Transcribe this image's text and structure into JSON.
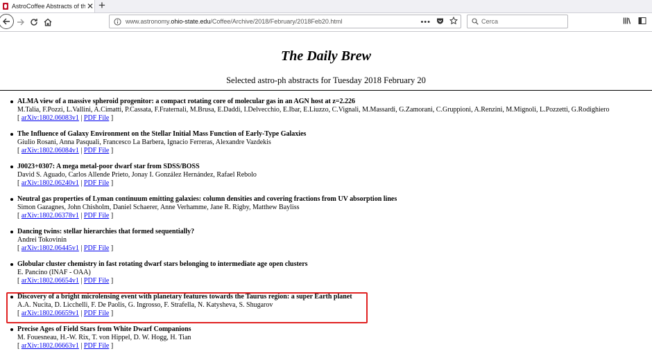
{
  "browser": {
    "tab_title": "AstroCoffee Abstracts of the D",
    "url_prefix": "www.astronomy.",
    "url_domain": "ohio-state.edu",
    "url_path": "/Coffee/Archive/2018/February/2018Feb20.html",
    "search_placeholder": "Cerca",
    "icons": {
      "favicon": "osu-favicon-icon",
      "close": "close-icon",
      "newtab": "plus-icon",
      "back": "back-arrow-icon",
      "forward": "forward-arrow-icon",
      "reload": "reload-icon",
      "home": "home-icon",
      "info": "info-icon",
      "menu": "ellipsis-icon",
      "pocket": "pocket-icon",
      "bookmark": "star-icon",
      "search": "search-icon",
      "library": "library-icon",
      "sidebar": "sidebar-icon"
    },
    "colors": {
      "favicon": "#c0102a"
    }
  },
  "page": {
    "title": "The Daily Brew",
    "subtitle": "Selected astro-ph abstracts for Tuesday 2018 February 20",
    "link_open": "[ ",
    "link_sep": " | ",
    "link_close": " ]",
    "pdf_label": "PDF File",
    "colors": {
      "link": "#0000ee",
      "highlight": "#e02020"
    },
    "papers": [
      {
        "title": "ALMA view of a massive spheroid progenitor: a compact rotating core of molecular gas in an AGN host at z=2.226",
        "authors": "M.Talia, F.Pozzi, L.Vallini, A.Cimatti, P.Cassata, F.Fraternali, M.Brusa, E.Daddi, I.Delvecchio, E.Ibar, E.Liuzzo, C.Vignali, M.Massardi, G.Zamorani, C.Gruppioni, A.Renzini, M.Mignoli, L.Pozzetti, G.Rodighiero",
        "arxiv": "arXiv:1802.06083v1"
      },
      {
        "title": "The Influence of Galaxy Environment on the Stellar Initial Mass Function of Early-Type Galaxies",
        "authors": "Giulio Rosani, Anna Pasquali, Francesco La Barbera, Ignacio Ferreras, Alexandre Vazdekis",
        "arxiv": "arXiv:1802.06084v1"
      },
      {
        "title": "J0023+0307: A mega metal-poor dwarf star from SDSS/BOSS",
        "authors": "David S. Aguado, Carlos Allende Prieto, Jonay I. González Hernández, Rafael Rebolo",
        "arxiv": "arXiv:1802.06240v1"
      },
      {
        "title": "Neutral gas properties of Lyman continuum emitting galaxies: column densities and covering fractions from UV absorption lines",
        "authors": "Simon Gazagnes, John Chisholm, Daniel Schaerer, Anne Verhamme, Jane R. Rigby, Matthew Bayliss",
        "arxiv": "arXiv:1802.06378v1"
      },
      {
        "title": "Dancing twins: stellar hierarchies that formed sequentially?",
        "authors": "Andrei Tokovinin",
        "arxiv": "arXiv:1802.06445v1"
      },
      {
        "title": "Globular cluster chemistry in fast rotating dwarf stars belonging to intermediate age open clusters",
        "authors": "E. Pancino (INAF - OAA)",
        "arxiv": "arXiv:1802.06654v1"
      },
      {
        "title": "Discovery of a bright microlensing event with planetary features towards the Taurus region: a super Earth planet",
        "authors": "A.A. Nucita, D. Licchelli, F. De Paolis, G. Ingrosso, F. Strafella, N. Katysheva, S. Shugarov",
        "arxiv": "arXiv:1802.06659v1"
      },
      {
        "title": "Precise Ages of Field Stars from White Dwarf Companions",
        "authors": "M. Fouesneau, H.-W. Rix, T. von Hippel, D. W. Hogg, H. Tian",
        "arxiv": "arXiv:1802.06663v1"
      }
    ]
  }
}
